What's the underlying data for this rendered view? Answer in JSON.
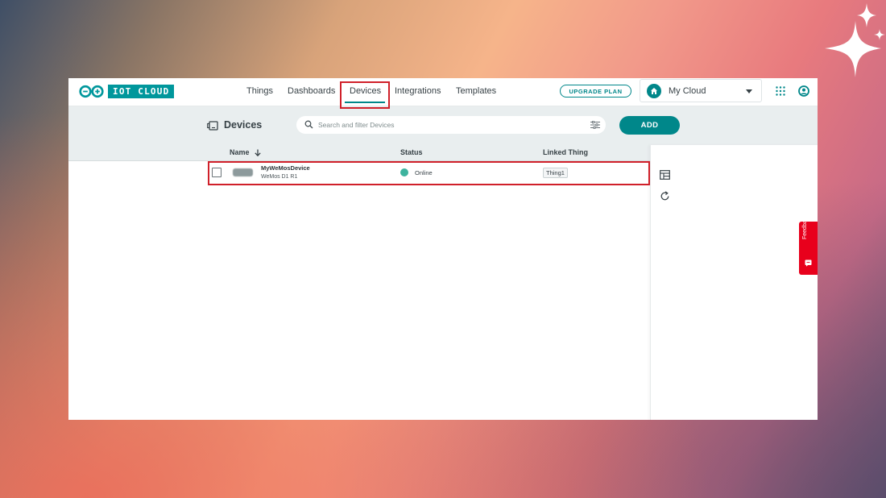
{
  "header": {
    "logo_text": "IOT CLOUD",
    "nav": [
      {
        "label": "Things"
      },
      {
        "label": "Dashboards"
      },
      {
        "label": "Devices",
        "active": true
      },
      {
        "label": "Integrations"
      },
      {
        "label": "Templates"
      }
    ],
    "upgrade_label": "UPGRADE PLAN",
    "space_label": "My Cloud"
  },
  "toolbar": {
    "title": "Devices",
    "search_placeholder": "Search and filter Devices",
    "add_label": "ADD"
  },
  "table": {
    "columns": [
      "Name",
      "Status",
      "Linked Thing"
    ],
    "sort_column": "Name",
    "rows": [
      {
        "name": "MyWeMosDevice",
        "type": "WeMos D1 R1",
        "status": "Online",
        "linked_thing": "Thing1"
      }
    ]
  },
  "feedback_label": "Feedback",
  "colors": {
    "accent": "#00878a",
    "logo": "#00979c",
    "status_online": "#3db39e",
    "highlight": "#d0202a",
    "feedback": "#e8001c"
  },
  "icons": [
    "arduino-logo-icon",
    "home-icon",
    "chevron-down-icon",
    "apps-grid-icon",
    "account-icon",
    "devices-icon",
    "search-icon",
    "filter-icon",
    "sort-arrow-down-icon",
    "table-view-icon",
    "refresh-icon",
    "feedback-icon",
    "sparkle-icon"
  ]
}
